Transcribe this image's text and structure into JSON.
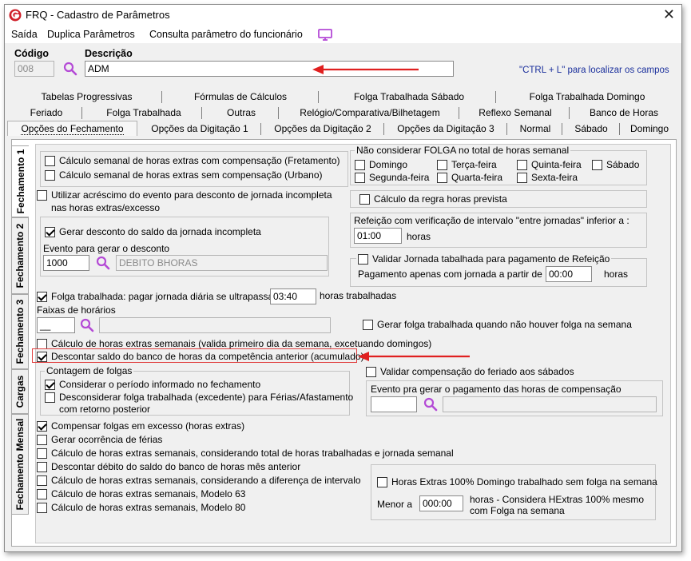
{
  "window": {
    "title": "FRQ - Cadastro de Parâmetros",
    "close_glyph": "✕"
  },
  "menu": {
    "items": [
      "Saída",
      "Duplica Parâmetros",
      "Consulta parâmetro do funcionário"
    ]
  },
  "header": {
    "codigo_label": "Código",
    "codigo_value": "008",
    "descricao_label": "Descrição",
    "descricao_value": "ADM",
    "hint": "\"CTRL + L\" para localizar os campos"
  },
  "tabs": {
    "row1": [
      "Tabelas Progressivas",
      "Fórmulas de Cálculos",
      "Folga Trabalhada Sábado",
      "Folga Trabalhada Domingo"
    ],
    "row2": [
      "Feriado",
      "Folga Trabalhada",
      "Outras",
      "Relógio/Comparativa/Bilhetagem",
      "Reflexo Semanal",
      "Banco de Horas"
    ],
    "row3": [
      "Opções do Fechamento",
      "Opções da Digitação 1",
      "Opções da Digitação 2",
      "Opções da Digitação 3",
      "Normal",
      "Sábado",
      "Domingo"
    ]
  },
  "vtabs": [
    "Fechamento 1",
    "Fechamento 2",
    "Fechamento 3",
    "Cargas",
    "Fechamento Mensal"
  ],
  "opts": {
    "fretamento": "Cálculo semanal de horas extras com compensação (Fretamento)",
    "urbano": "Cálculo semanal de horas extras sem compensação (Urbano)",
    "acrescimo_l1": "Utilizar acréscimo do evento para desconto de jornada incompleta",
    "acrescimo_l2": "nas horas extras/excesso",
    "gerar_desconto": "Gerar desconto do saldo da jornada incompleta",
    "evento_desconto_label": "Evento para gerar o desconto",
    "evento_desconto_code": "1000",
    "evento_desconto_desc": "DEBITO BHORAS",
    "folga_trab": "Folga trabalhada: pagar jornada diária se ultrapassar",
    "folga_trab_value": "03:40",
    "folga_trab_suffix": "horas trabalhadas",
    "faixas_label": "Faixas de horários",
    "faixas_value": "__",
    "gerar_folga": "Gerar folga trabalhada quando não houver folga na semana",
    "calc_semanais": "Cálculo de horas extras semanais (valida primeiro dia da semana, excetuando domingos)",
    "descontar_saldo": "Descontar saldo do banco de horas da competência anterior (acumulado)",
    "validar_feriado": "Validar compensação do feriado aos sábados",
    "contagem_title": "Contagem de  folgas",
    "considerar_periodo": "Considerar o período informado no fechamento",
    "desconsiderar_l1": "Desconsiderar folga trabalhada (excedente) para Férias/Afastamento",
    "desconsiderar_l2": "com retorno posterior",
    "evento_comp_title": "Evento pra gerar o pagamento das horas de compensação",
    "compensar": "Compensar folgas em excesso (horas extras)",
    "ocorrencia_ferias": "Gerar ocorrência de férias",
    "calc_total": "Cálculo de horas extras semanais, considerando total de horas trabalhadas e jornada semanal",
    "descontar_debito": "Descontar débito do saldo do banco de horas mês anterior",
    "calc_diferenca": "Cálculo de horas extras semanais, considerando a diferença de intervalo",
    "modelo63": "Cálculo de horas extras semanais, Modelo 63",
    "modelo80": "Cálculo de horas extras semanais, Modelo 80"
  },
  "folga_group": {
    "title": "Não considerar FOLGA no total de horas semanal",
    "days": [
      "Domingo",
      "Terça-feira",
      "Quinta-feira",
      "Sábado",
      "Segunda-feira",
      "Quarta-feira",
      "Sexta-feira"
    ]
  },
  "regra_prevista": "Cálculo da regra horas prevista",
  "refeicao": {
    "title": "Refeição com verificação de intervalo  \"entre jornadas\" inferior a :",
    "value": "01:00",
    "unit": "horas"
  },
  "validar_jornada": {
    "title": "Validar Jornada tabalhada para pagamento de Refeição",
    "label": "Pagamento apenas com jornada a partir de :",
    "value": "00:00",
    "unit": "horas"
  },
  "he100": {
    "title": "Horas Extras 100% Domingo trabalhado sem folga na semana",
    "menor_label": "Menor a",
    "value": "000:00",
    "desc_l1": "horas - Considera  HExtras 100% mesmo",
    "desc_l2": "com Folga na semana"
  },
  "colors": {
    "accent": "#1a2f9c",
    "arrow": "#e02020",
    "icon": "#b44ad6",
    "logo": "#d0202a"
  }
}
